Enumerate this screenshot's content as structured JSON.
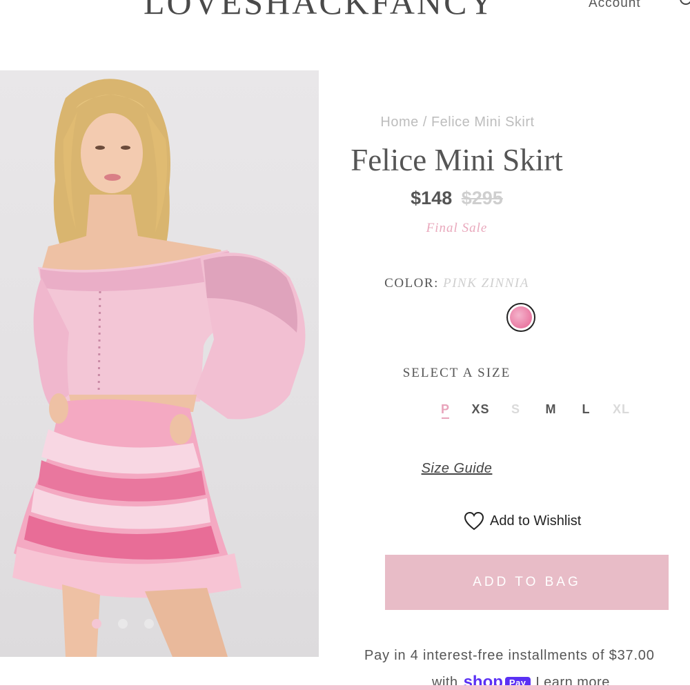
{
  "header": {
    "logo": "LOVESHACKFANCY",
    "account_label": "Account",
    "search_icon": "search-icon"
  },
  "gallery": {
    "image_description": "Model wearing pink tie-dye off-shoulder top and tiered mini skirt with lace trim",
    "slides_total": 3,
    "active_slide": 1
  },
  "product": {
    "breadcrumb": {
      "home": "Home",
      "separator": " / ",
      "current": "Felice Mini Skirt"
    },
    "title": "Felice Mini Skirt",
    "price": "$148",
    "original_price": "$295",
    "sale_label": "Final Sale",
    "color_label": "COLOR: ",
    "color_value": "PINK ZINNIA",
    "swatch_color": "#ea7aa3",
    "size_title": "SELECT A SIZE",
    "sizes": [
      {
        "label": "P",
        "state": "selected"
      },
      {
        "label": "XS",
        "state": "available"
      },
      {
        "label": "S",
        "state": "unavailable"
      },
      {
        "label": "M",
        "state": "available"
      },
      {
        "label": "L",
        "state": "available"
      },
      {
        "label": "XL",
        "state": "unavailable"
      }
    ],
    "size_guide": "Size Guide",
    "wishlist": "Add to Wishlist",
    "add_to_bag": "ADD TO BAG",
    "installments": "Pay in 4 interest-free installments of $37.00",
    "shop_pay_prefix": "with",
    "shop_pay_shop": "shop",
    "shop_pay_pay": "Pay",
    "learn_more": "Learn more"
  },
  "colors": {
    "accent_pink": "#e8bcc7",
    "text_gray": "#555555",
    "shop_pay_purple": "#5a31f4"
  }
}
